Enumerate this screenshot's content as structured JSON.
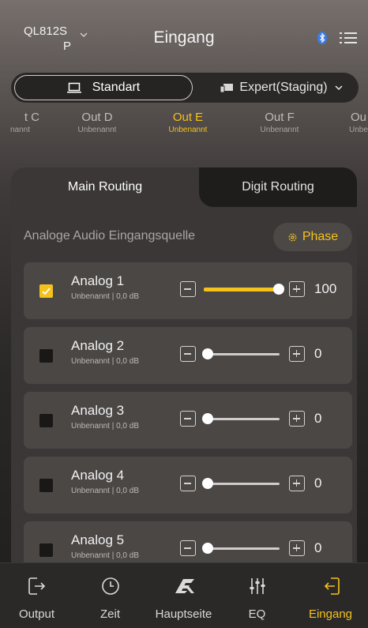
{
  "header": {
    "device_line1": "QL812S",
    "device_line2": "P",
    "title": "Eingang"
  },
  "mode": {
    "standard_label": "Standart",
    "expert_label": "Expert(Staging)"
  },
  "outputs": [
    {
      "name": "t C",
      "sub": "nannt"
    },
    {
      "name": "Out D",
      "sub": "Unbenannt"
    },
    {
      "name": "Out E",
      "sub": "Unbenannt"
    },
    {
      "name": "Out F",
      "sub": "Unbenannt"
    },
    {
      "name": "Ou",
      "sub": "Unbe"
    }
  ],
  "tabs": {
    "main": "Main Routing",
    "digit": "Digit Routing"
  },
  "source_label": "Analoge Audio Eingangsquelle",
  "phase_label": "Phase",
  "rows": [
    {
      "name": "Analog 1",
      "sub": "Unbenannt | 0,0 dB",
      "value": "100",
      "checked": true
    },
    {
      "name": "Analog 2",
      "sub": "Unbenannt | 0,0 dB",
      "value": "0",
      "checked": false
    },
    {
      "name": "Analog 3",
      "sub": "Unbenannt | 0,0 dB",
      "value": "0",
      "checked": false
    },
    {
      "name": "Analog 4",
      "sub": "Unbenannt | 0,0 dB",
      "value": "0",
      "checked": false
    },
    {
      "name": "Analog 5",
      "sub": "Unbenannt | 0,0 dB",
      "value": "0",
      "checked": false
    }
  ],
  "nav": [
    {
      "label": "Output",
      "icon": "output-icon"
    },
    {
      "label": "Zeit",
      "icon": "clock-icon"
    },
    {
      "label": "Hauptseite",
      "icon": "esx-logo-icon"
    },
    {
      "label": "EQ",
      "icon": "equalizer-icon"
    },
    {
      "label": "Eingang",
      "icon": "input-icon"
    }
  ],
  "colors": {
    "accent": "#f5c21b",
    "row_bg": "#4a4745",
    "panel_bg": "#3a3736"
  }
}
